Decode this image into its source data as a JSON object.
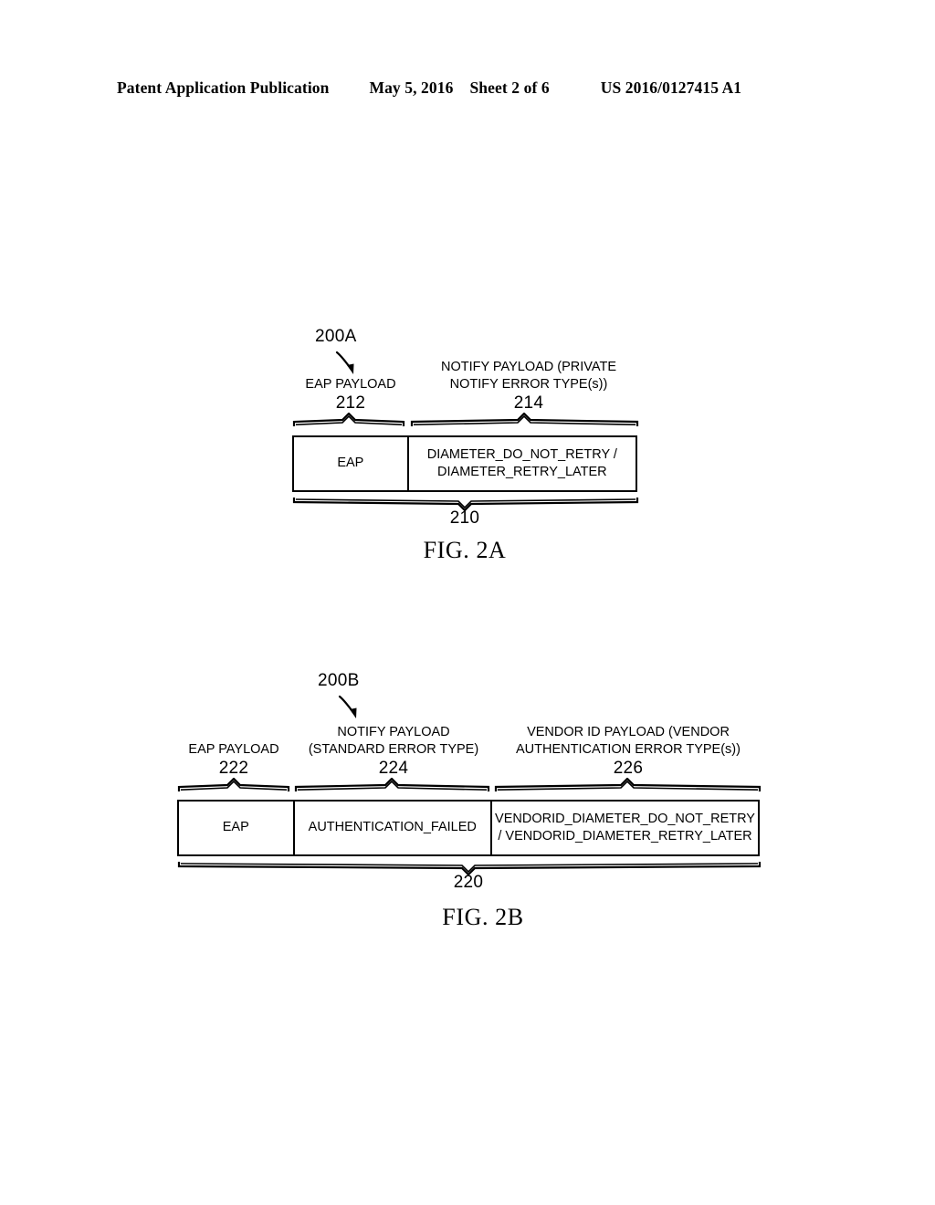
{
  "header": {
    "publication": "Patent Application Publication",
    "date": "May 5, 2016",
    "sheet": "Sheet 2 of 6",
    "doc_number": "US 2016/0127415 A1"
  },
  "figures": [
    {
      "id": "fig-2a",
      "caption": "FIG. 2A",
      "callout": "200A",
      "packet_ref": "210",
      "fields": [
        {
          "label": "EAP PAYLOAD",
          "num": "212",
          "cell": "EAP"
        },
        {
          "label": "NOTIFY PAYLOAD (PRIVATE\nNOTIFY ERROR TYPE(s))",
          "num": "214",
          "cell": "DIAMETER_DO_NOT_RETRY /\nDIAMETER_RETRY_LATER"
        }
      ]
    },
    {
      "id": "fig-2b",
      "caption": "FIG. 2B",
      "callout": "200B",
      "packet_ref": "220",
      "fields": [
        {
          "label": "EAP PAYLOAD",
          "num": "222",
          "cell": "EAP"
        },
        {
          "label": "NOTIFY PAYLOAD\n(STANDARD ERROR TYPE)",
          "num": "224",
          "cell": "AUTHENTICATION_FAILED"
        },
        {
          "label": "VENDOR ID PAYLOAD (VENDOR\nAUTHENTICATION ERROR TYPE(s))",
          "num": "226",
          "cell": "VENDORID_DIAMETER_DO_NOT_RETRY\n/ VENDORID_DIAMETER_RETRY_LATER"
        }
      ]
    }
  ]
}
